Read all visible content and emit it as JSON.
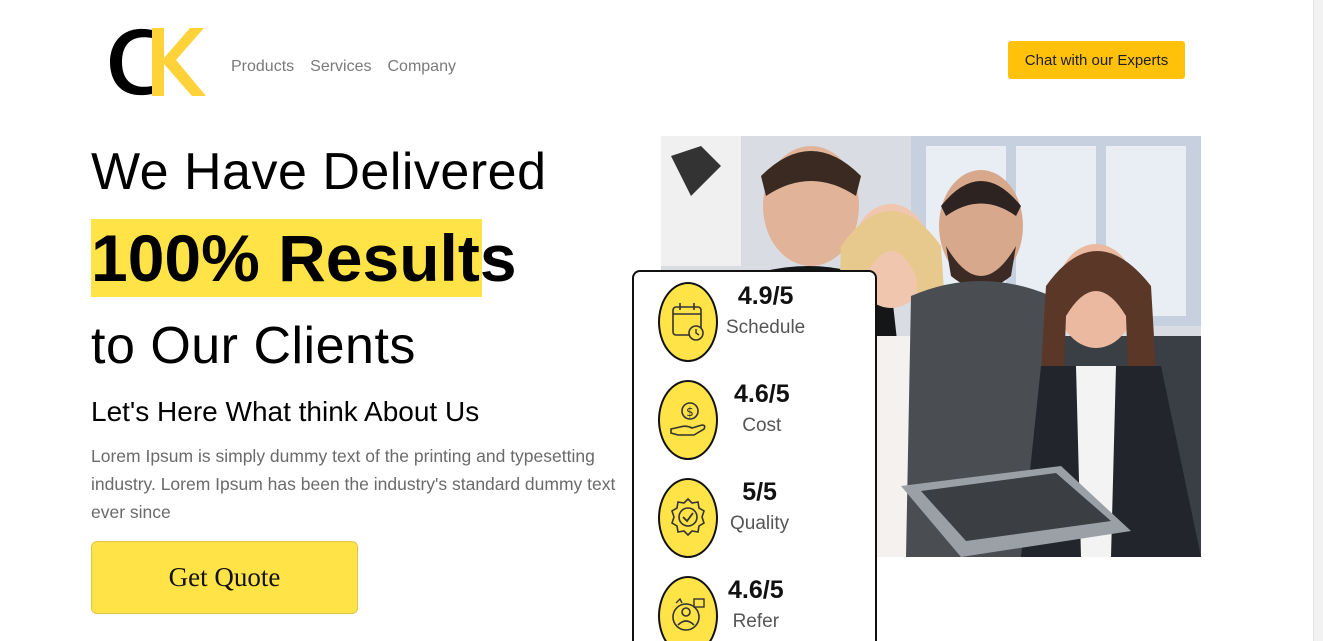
{
  "header": {
    "logo_text": "CK",
    "nav": [
      {
        "label": "Products"
      },
      {
        "label": "Services"
      },
      {
        "label": "Company"
      }
    ],
    "cta_label": "Chat with our Experts"
  },
  "hero": {
    "line1": "We Have Delivered",
    "line2": "100% Results",
    "line3": "to Our Clients",
    "subhead": "Let's Here What think About Us",
    "paragraph": "Lorem Ipsum is simply dummy text of the printing and typesetting industry. Lorem Ipsum has been the industry's standard dummy text ever since",
    "button_label": "Get Quote"
  },
  "ratings": [
    {
      "score": "4.9/5",
      "label": "Schedule",
      "icon": "calendar-clock-icon"
    },
    {
      "score": "4.6/5",
      "label": "Cost",
      "icon": "hand-dollar-icon"
    },
    {
      "score": "5/5",
      "label": "Quality",
      "icon": "quality-badge-icon"
    },
    {
      "score": "4.6/5",
      "label": "Refer",
      "icon": "referral-icon"
    }
  ],
  "colors": {
    "accent_yellow": "#ffe347",
    "cta_yellow": "#ffc10a",
    "text_dark": "#000000",
    "text_muted": "#6a6a6a"
  }
}
